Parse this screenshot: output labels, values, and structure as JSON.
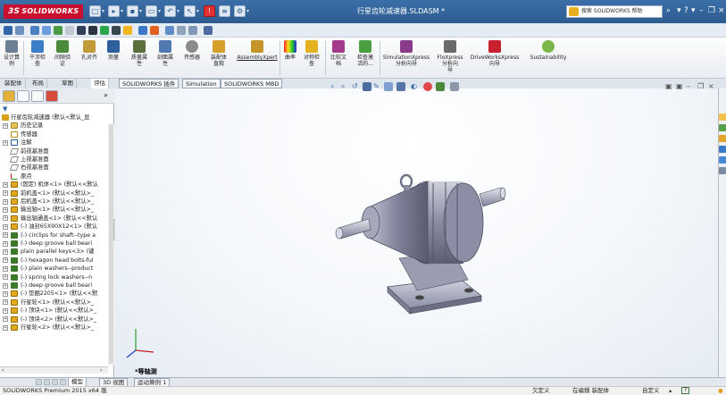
{
  "app": {
    "logo_prefix": "3S",
    "logo_text": "SOLIDWORKS",
    "document_title": "行星齿轮减速器.SLDASM *",
    "help_search_placeholder": "搜索 SOLIDWORKS 帮助"
  },
  "ribbon": {
    "buttons": [
      {
        "label": "设计算\n例"
      },
      {
        "label": "干涉检\n查"
      },
      {
        "label": "间隙验\n证"
      },
      {
        "label": "孔对齐"
      },
      {
        "label": "测量"
      },
      {
        "label": "质量属\n性"
      },
      {
        "label": "剖面属\n性"
      },
      {
        "label": "传感器"
      },
      {
        "label": "装配体\n直观"
      },
      {
        "label": "AssemblyXpert"
      },
      {
        "label": "曲率"
      },
      {
        "label": "对称检\n查"
      },
      {
        "label": "比较文\n档"
      },
      {
        "label": "检查激\n活的..."
      },
      {
        "label": "SimulationXpress\n分析向导"
      },
      {
        "label": "FloXpress\n分析向\n导"
      },
      {
        "label": "DriveWorksXpress\n向导"
      },
      {
        "label": "Sustainability"
      }
    ]
  },
  "tabs": [
    {
      "label": "装配体"
    },
    {
      "label": "布局"
    },
    {
      "label": "草图"
    },
    {
      "label": "评估"
    },
    {
      "label": "SOLIDWORKS 插件"
    },
    {
      "label": "Simulation"
    },
    {
      "label": "SOLIDWORKS MBD"
    }
  ],
  "tree": {
    "root": "行星齿轮减速器 (默认<默认_显",
    "items": [
      {
        "icon": "folder",
        "label": "历史记录"
      },
      {
        "icon": "sensor",
        "label": "传感器"
      },
      {
        "icon": "note",
        "label": "注解"
      },
      {
        "icon": "plane",
        "label": "前视基准面"
      },
      {
        "icon": "plane",
        "label": "上视基准面"
      },
      {
        "icon": "plane",
        "label": "右视基准面"
      },
      {
        "icon": "origin",
        "label": "原点"
      },
      {
        "icon": "part",
        "label": "(固定) 机体<1> (默认<<默认"
      },
      {
        "icon": "part",
        "label": "前机盖<1> (默认<<默认>_"
      },
      {
        "icon": "part",
        "label": "后机盖<1> (默认<<默认>_"
      },
      {
        "icon": "part",
        "label": "输出轴<1> (默认<<默认>_"
      },
      {
        "icon": "part",
        "label": "输出轴通盖<1> (默认<<默认"
      },
      {
        "icon": "part",
        "label": "(-) 油封65X90X12<1> (默认"
      },
      {
        "icon": "tool",
        "label": "(-) circlips for shaft--type a"
      },
      {
        "icon": "tool",
        "label": "(-) deep groove ball beari"
      },
      {
        "icon": "tool",
        "label": "plain parallel keys<3> (键"
      },
      {
        "icon": "tool",
        "label": "(-) hexagon head bolts-ful"
      },
      {
        "icon": "tool",
        "label": "(-) plain washers--product"
      },
      {
        "icon": "tool",
        "label": "(-) spring lock washers--n"
      },
      {
        "icon": "tool",
        "label": "(-) deep groove ball beari"
      },
      {
        "icon": "part",
        "label": "(-) 垫圈2205<1> (默认<<默"
      },
      {
        "icon": "part",
        "label": "行星轮<1> (默认<<默认>_"
      },
      {
        "icon": "part",
        "label": "(-) 顶块<1> (默认<<默认>_"
      },
      {
        "icon": "part",
        "label": "(-) 顶块<2> (默认<<默认>_"
      },
      {
        "icon": "part",
        "label": "行星轮<2> (默认<<默认>_"
      }
    ]
  },
  "viewport": {
    "view_label": "*等轴测"
  },
  "model_tabs": [
    {
      "label": "模型"
    },
    {
      "label": "3D 视图"
    },
    {
      "label": "运动算例 1"
    }
  ],
  "status": {
    "app_version": "SOLIDWORKS Premium 2015 x64 版",
    "underdefined": "欠定义",
    "editing": "在编辑 装配体",
    "custom": "自定义"
  },
  "colors": {
    "titlebar": "#2d5b8f",
    "logo": "#c8102e",
    "model_body": "#9ea0b4"
  }
}
